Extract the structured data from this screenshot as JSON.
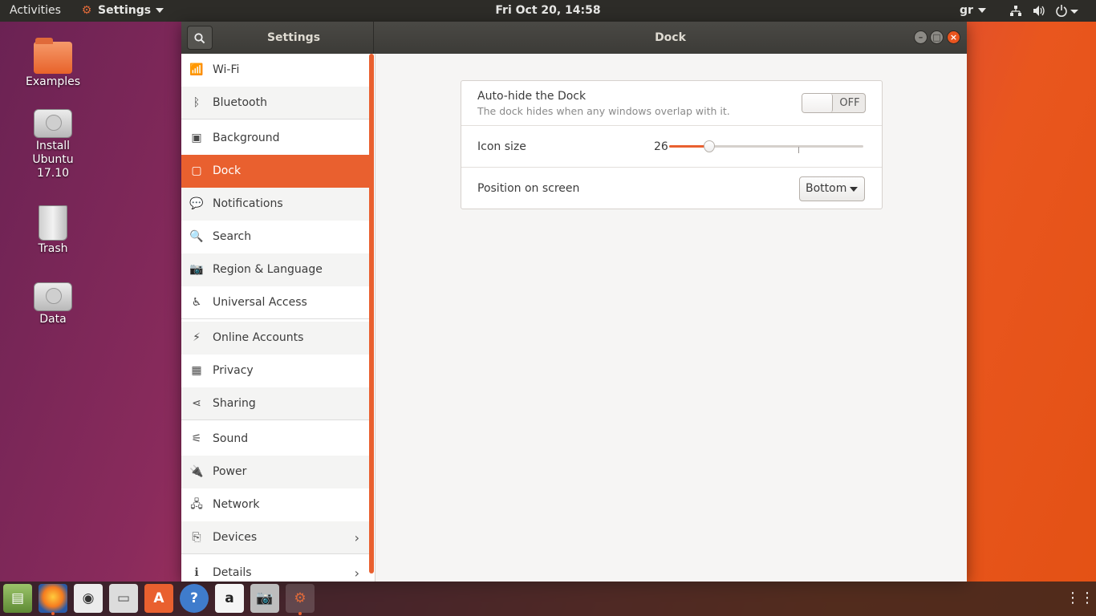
{
  "topbar": {
    "activities": "Activities",
    "app_menu": "Settings",
    "clock": "Fri Oct 20, 14:58",
    "keyboard_layout": "gr"
  },
  "desktop": {
    "icons": [
      {
        "label": "Examples"
      },
      {
        "label": "Install\nUbuntu\n17.10"
      },
      {
        "label": "Trash"
      },
      {
        "label": "Data"
      }
    ]
  },
  "window": {
    "sidebar_title": "Settings",
    "panel_title": "Dock"
  },
  "sidebar": {
    "items": [
      {
        "label": "Wi-Fi",
        "icon": "wifi-icon"
      },
      {
        "label": "Bluetooth",
        "icon": "bluetooth-icon"
      },
      {
        "label": "Background",
        "icon": "background-icon"
      },
      {
        "label": "Dock",
        "icon": "dock-icon"
      },
      {
        "label": "Notifications",
        "icon": "notifications-icon"
      },
      {
        "label": "Search",
        "icon": "search-icon"
      },
      {
        "label": "Region & Language",
        "icon": "region-icon"
      },
      {
        "label": "Universal Access",
        "icon": "universal-access-icon"
      },
      {
        "label": "Online Accounts",
        "icon": "online-accounts-icon"
      },
      {
        "label": "Privacy",
        "icon": "privacy-icon"
      },
      {
        "label": "Sharing",
        "icon": "sharing-icon"
      },
      {
        "label": "Sound",
        "icon": "sound-icon"
      },
      {
        "label": "Power",
        "icon": "power-icon"
      },
      {
        "label": "Network",
        "icon": "network-icon"
      },
      {
        "label": "Devices",
        "icon": "devices-icon"
      },
      {
        "label": "Details",
        "icon": "details-icon"
      }
    ],
    "active": "Dock"
  },
  "dock_panel": {
    "autohide_title": "Auto-hide the Dock",
    "autohide_desc": "The dock hides when any windows overlap with it.",
    "autohide_state": "OFF",
    "icon_size_label": "Icon size",
    "icon_size_value": "26",
    "icon_size_min": 16,
    "icon_size_max": 64,
    "position_label": "Position on screen",
    "position_value": "Bottom"
  },
  "launcher": {
    "apps": [
      {
        "name": "files-app"
      },
      {
        "name": "firefox-app"
      },
      {
        "name": "rhythmbox-app"
      },
      {
        "name": "file-manager-app"
      },
      {
        "name": "software-center-app"
      },
      {
        "name": "help-app"
      },
      {
        "name": "amazon-app"
      },
      {
        "name": "screenshot-app"
      },
      {
        "name": "settings-app"
      }
    ],
    "amazon_glyph": "a",
    "help_glyph": "?",
    "software_glyph": "A"
  },
  "colors": {
    "accent": "#e9602f",
    "topbar": "#2d2c28",
    "titlebar": "#3c3b37"
  }
}
